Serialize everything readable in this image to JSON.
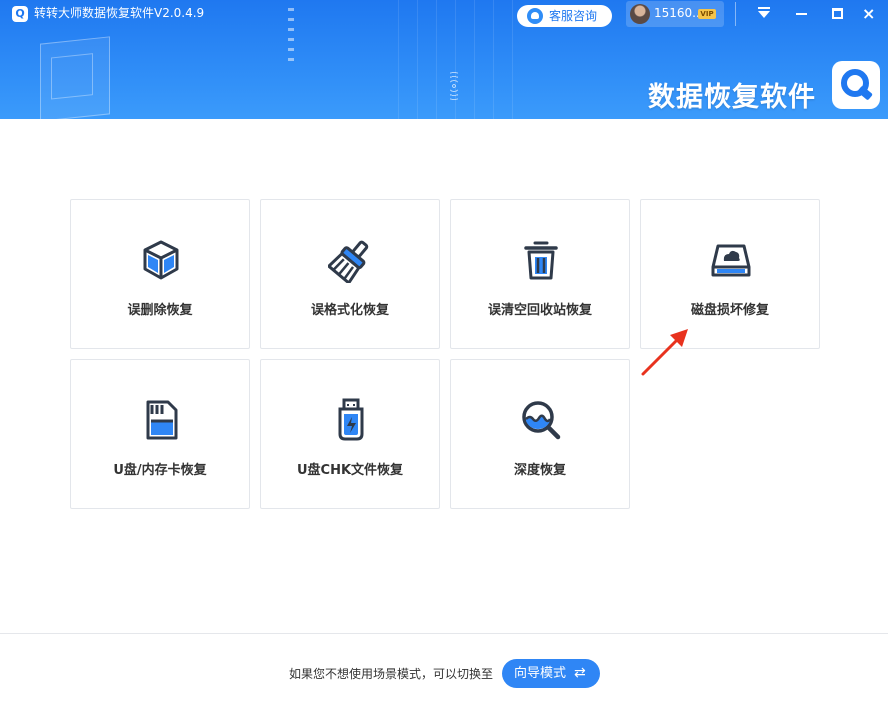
{
  "window": {
    "title": "转转大师数据恢复软件V2.0.4.9",
    "logo_glyph": "Q"
  },
  "header": {
    "service_label": "客服咨询",
    "user_name": "15160...",
    "vip_badge": "VIP",
    "brand_text": "数据恢复软件",
    "colors": {
      "primary": "#1f78f0",
      "accent": "#2f8df7"
    }
  },
  "window_controls": {
    "menu_icon": "menu-dropdown-icon",
    "minimize_icon": "minimize-icon",
    "maximize_icon": "maximize-icon",
    "close_glyph": "×"
  },
  "modes": [
    {
      "label": "误删除恢复",
      "icon": "cube-icon"
    },
    {
      "label": "误格式化恢复",
      "icon": "broom-icon"
    },
    {
      "label": "误清空回收站恢复",
      "icon": "trash-icon"
    },
    {
      "label": "磁盘损坏修复",
      "icon": "disk-icon"
    },
    {
      "label": "U盘/内存卡恢复",
      "icon": "sd-card-icon"
    },
    {
      "label": "U盘CHK文件恢复",
      "icon": "usb-drive-icon"
    },
    {
      "label": "深度恢复",
      "icon": "magnifier-icon"
    }
  ],
  "footer": {
    "prompt_text": "如果您不想使用场景模式，可以切换至",
    "guide_button_label": "向导模式",
    "guide_button_icon": "⇄"
  }
}
